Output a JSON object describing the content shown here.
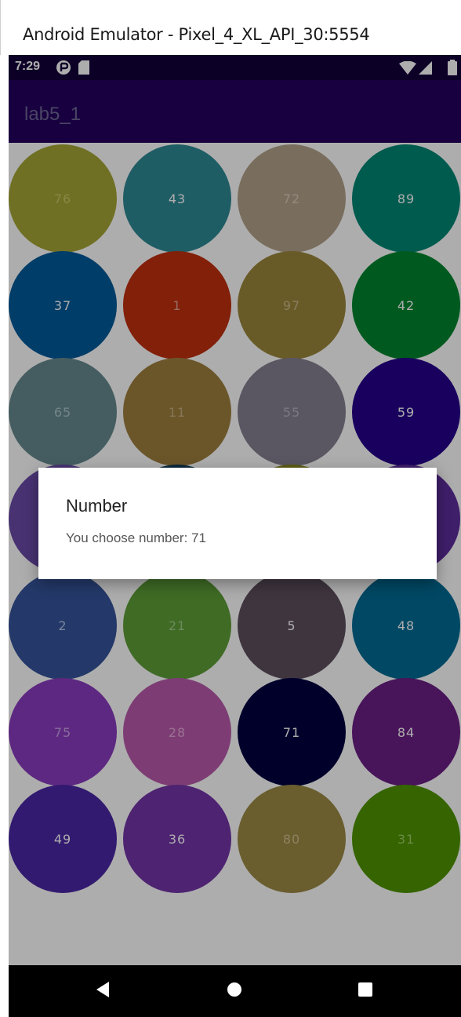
{
  "window": {
    "title": "Android Emulator - Pixel_4_XL_API_30:5554"
  },
  "status_bar": {
    "time": "7:29",
    "left_icons": [
      "sync-icon",
      "sd-card-icon"
    ],
    "right_icons": [
      "wifi-icon",
      "cellular-icon",
      "battery-icon"
    ]
  },
  "app_bar": {
    "title": "lab5_1",
    "color": "#24005f"
  },
  "grid": {
    "rows": [
      [
        {
          "number": "76",
          "color": "#a6a636",
          "text_color": "#c8c86a"
        },
        {
          "number": "43",
          "color": "#2f8a95",
          "text_color": "#ffffff"
        },
        {
          "number": "72",
          "color": "#b3a18a",
          "text_color": "#d9ccbc"
        },
        {
          "number": "89",
          "color": "#008775",
          "text_color": "#ffffff"
        }
      ],
      [
        {
          "number": "37",
          "color": "#005a9b",
          "text_color": "#ffffff"
        },
        {
          "number": "1",
          "color": "#c0300f",
          "text_color": "#e0a090"
        },
        {
          "number": "97",
          "color": "#9b863c",
          "text_color": "#c9b988"
        },
        {
          "number": "42",
          "color": "#00852e",
          "text_color": "#ffffff"
        }
      ],
      [
        {
          "number": "65",
          "color": "#66898f",
          "text_color": "#a8c4c8"
        },
        {
          "number": "11",
          "color": "#9e7f3e",
          "text_color": "#c8b080"
        },
        {
          "number": "55",
          "color": "#857f91",
          "text_color": "#b6b0c2"
        },
        {
          "number": "59",
          "color": "#26008c",
          "text_color": "#ffffff"
        }
      ],
      [
        {
          "number": "",
          "color": "#6a4aa8",
          "text_color": "#ffffff"
        },
        {
          "number": "",
          "color": "#123a57",
          "text_color": "#ffffff"
        },
        {
          "number": "",
          "color": "#8a8a1e",
          "text_color": "#ffffff"
        },
        {
          "number": "",
          "color": "#5e2d9c",
          "text_color": "#ffffff"
        }
      ],
      [
        {
          "number": "2",
          "color": "#36559b",
          "text_color": "#b4c4ea"
        },
        {
          "number": "21",
          "color": "#5e9e37",
          "text_color": "#a2cc86"
        },
        {
          "number": "5",
          "color": "#5e4e5e",
          "text_color": "#ffffff"
        },
        {
          "number": "48",
          "color": "#006b94",
          "text_color": "#ffffff"
        }
      ],
      [
        {
          "number": "75",
          "color": "#8a3cbe",
          "text_color": "#c8a0e6"
        },
        {
          "number": "28",
          "color": "#b85aab",
          "text_color": "#e2a6d8"
        },
        {
          "number": "71",
          "color": "#000040",
          "text_color": "#ffffff"
        },
        {
          "number": "84",
          "color": "#6a1e85",
          "text_color": "#ffffff"
        }
      ],
      [
        {
          "number": "49",
          "color": "#4a27a6",
          "text_color": "#ffffff"
        },
        {
          "number": "36",
          "color": "#7434a8",
          "text_color": "#ffffff"
        },
        {
          "number": "80",
          "color": "#9c8a45",
          "text_color": "#d0c090"
        },
        {
          "number": "31",
          "color": "#4f9400",
          "text_color": "#9fcc66"
        }
      ]
    ]
  },
  "dialog": {
    "title": "Number",
    "message": "You choose number: 71"
  },
  "nav_bar": {
    "buttons": [
      "back-icon",
      "home-icon",
      "recents-icon"
    ]
  }
}
